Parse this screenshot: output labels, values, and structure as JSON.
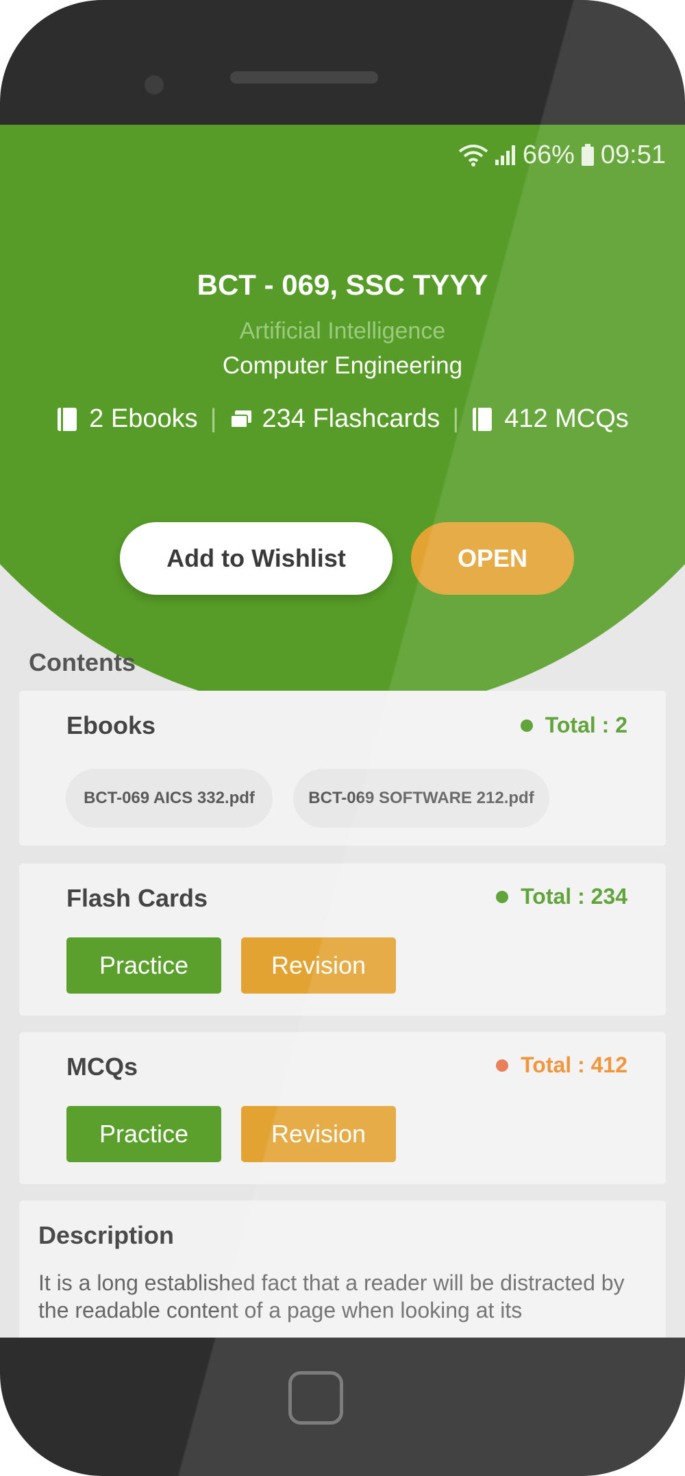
{
  "status_bar": {
    "battery": "66%",
    "time": "09:51"
  },
  "header": {
    "title": "BCT - 069, SSC TYYY",
    "subject": "Artificial Intelligence",
    "department": "Computer Engineering",
    "stats": {
      "ebooks": "2 Ebooks",
      "flashcards": "234 Flashcards",
      "mcqs": "412 MCQs",
      "separator": "|"
    }
  },
  "actions": {
    "wishlist_label": "Add to Wishlist",
    "open_label": "OPEN"
  },
  "contents": {
    "label": "Contents",
    "ebooks": {
      "title": "Ebooks",
      "total": "Total : 2",
      "files": [
        "BCT-069 AICS 332.pdf",
        "BCT-069 SOFTWARE 212.pdf"
      ]
    },
    "flashcards": {
      "title": "Flash Cards",
      "total": "Total : 234",
      "practice_label": "Practice",
      "revision_label": "Revision"
    },
    "mcqs": {
      "title": "MCQs",
      "total": "Total : 412",
      "practice_label": "Practice",
      "revision_label": "Revision"
    }
  },
  "description": {
    "title": "Description",
    "text": "It is a long established fact that a reader will be distracted by the readable content of a page when looking at its"
  },
  "colors": {
    "brand_green": "#579c28",
    "accent_orange": "#e2a332",
    "total_green": "#4e9a25",
    "total_orange": "#ee8a26",
    "dot_orange": "#e8714a"
  },
  "icons": [
    "wifi-icon",
    "signal-icon",
    "battery-icon",
    "book-icon",
    "flashcard-icon",
    "home-button-icon"
  ]
}
